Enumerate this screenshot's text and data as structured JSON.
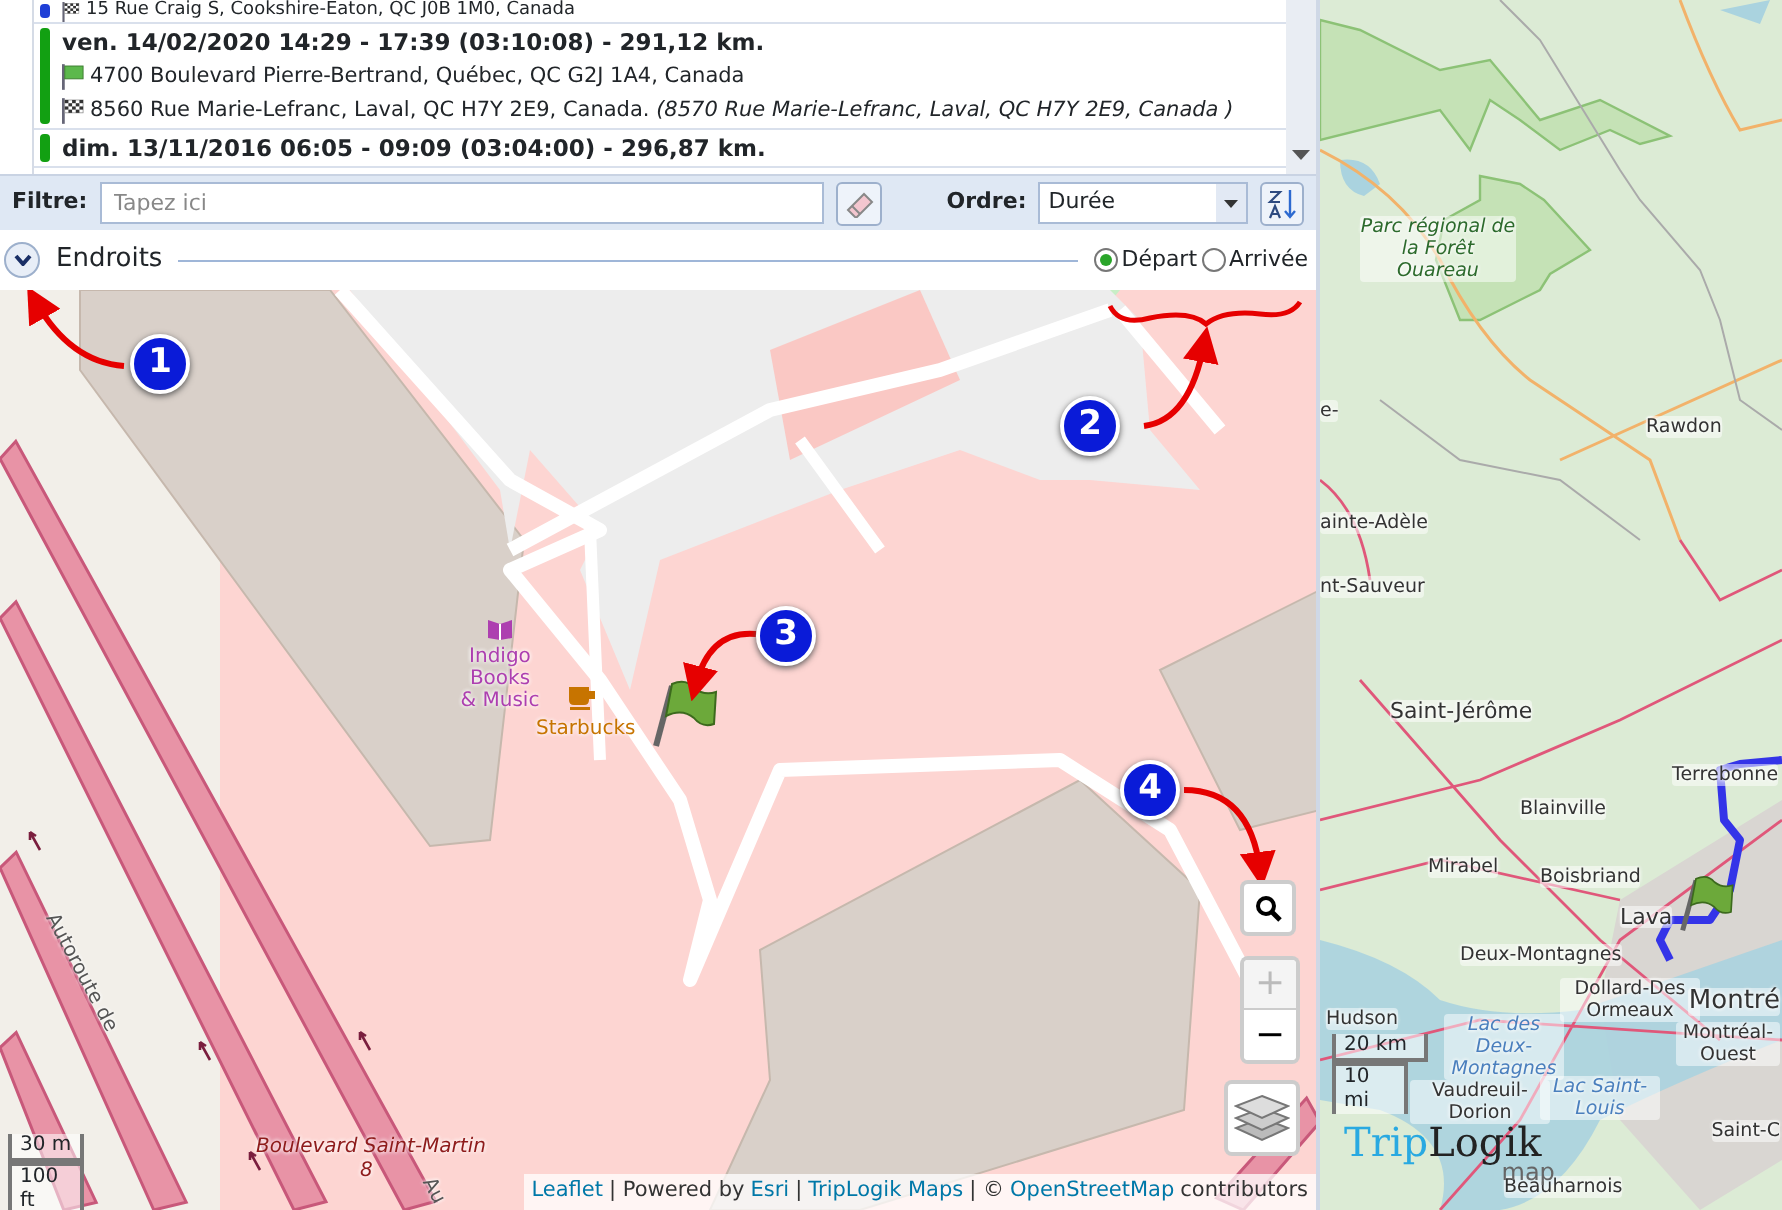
{
  "trip_list": {
    "trips": [
      {
        "color": "#1f3fd6",
        "stops": [
          {
            "kind": "end",
            "text": "15 Rue Craig S, Cookshire-Eaton, QC J0B 1M0, Canada"
          }
        ]
      },
      {
        "color": "#12a012",
        "header": "ven. 14/02/2020  14:29 - 17:39  (03:10:08) - 291,12 km.",
        "stops": [
          {
            "kind": "start",
            "text": "4700 Boulevard Pierre-Bertrand, Québec, QC G2J 1A4, Canada"
          },
          {
            "kind": "end",
            "text": "8560 Rue Marie-Lefranc, Laval, QC H7Y 2E9, Canada. *(8570 Rue Marie-Lefranc, Laval, QC H7Y 2E9, Canada )*"
          }
        ]
      },
      {
        "color": "#12a012",
        "header": "dim. 13/11/2016  06:05 - 09:09  (03:04:00) - 296,87 km."
      }
    ]
  },
  "filter_bar": {
    "filter_label": "Filtre:",
    "filter_placeholder": "Tapez ici",
    "order_label": "Ordre:",
    "order_value": "Durée"
  },
  "places": {
    "title": "Endroits",
    "expanded": true,
    "options": [
      {
        "label": "Départ",
        "selected": true
      },
      {
        "label": "Arrivée",
        "selected": false
      }
    ]
  },
  "detail_map": {
    "labels": [
      {
        "kind": "poi",
        "text": "Indigo Books & Music"
      },
      {
        "kind": "cafe",
        "text": "Starbucks"
      },
      {
        "kind": "street",
        "text": "Boulevard Saint-Martin"
      },
      {
        "kind": "route",
        "text": "8"
      },
      {
        "kind": "highway",
        "text": "Autoroute de"
      },
      {
        "kind": "highway2",
        "text": "Au"
      }
    ],
    "callouts": [
      "1",
      "2",
      "3",
      "4"
    ],
    "zoom_in": {
      "symbol": "+",
      "disabled": true
    },
    "zoom_out": {
      "symbol": "−",
      "disabled": false
    },
    "scale": [
      "30 m",
      "100 ft"
    ],
    "attribution": [
      {
        "kind": "link",
        "text": "Leaflet"
      },
      {
        "kind": "text",
        "text": "| Powered by"
      },
      {
        "kind": "link",
        "text": "Esri"
      },
      {
        "kind": "text",
        "text": "|"
      },
      {
        "kind": "link",
        "text": "TripLogik Maps"
      },
      {
        "kind": "text",
        "text": "| ©"
      },
      {
        "kind": "link",
        "text": "OpenStreetMap"
      },
      {
        "kind": "text",
        "text": "contributors"
      }
    ]
  },
  "overview_map": {
    "labels": [
      {
        "kind": "park",
        "text": "Parc régional de la Forêt Ouareau"
      },
      {
        "kind": "town",
        "text": "e-"
      },
      {
        "kind": "town",
        "text": "Rawdon"
      },
      {
        "kind": "town",
        "text": "ainte-Adèle"
      },
      {
        "kind": "town",
        "text": "nt-Sauveur"
      },
      {
        "kind": "city",
        "text": "Saint-Jérôme"
      },
      {
        "kind": "town",
        "text": "Terrebonne"
      },
      {
        "kind": "town",
        "text": "Blainville"
      },
      {
        "kind": "town",
        "text": "Mirabel"
      },
      {
        "kind": "town",
        "text": "Boisbriand"
      },
      {
        "kind": "city",
        "text": "Lava"
      },
      {
        "kind": "town",
        "text": "Deux-Montagnes"
      },
      {
        "kind": "town",
        "text": "Dollard-Des Ormeaux"
      },
      {
        "kind": "bigcity",
        "text": "Montré"
      },
      {
        "kind": "town",
        "text": "Montréal-Ouest"
      },
      {
        "kind": "town",
        "text": "Hudson"
      },
      {
        "kind": "water",
        "text": "Lac des Deux-Montagnes"
      },
      {
        "kind": "town",
        "text": "Vaudreuil-Dorion"
      },
      {
        "kind": "water",
        "text": "Lac Saint-Louis"
      },
      {
        "kind": "town",
        "text": "Saint-C"
      },
      {
        "kind": "town",
        "text": "Beauharnois"
      }
    ],
    "scale": [
      "20 km",
      "10 mi"
    ],
    "logo": {
      "part_1": "Trip",
      "part_2": "Logik",
      "part_3": "map"
    }
  }
}
